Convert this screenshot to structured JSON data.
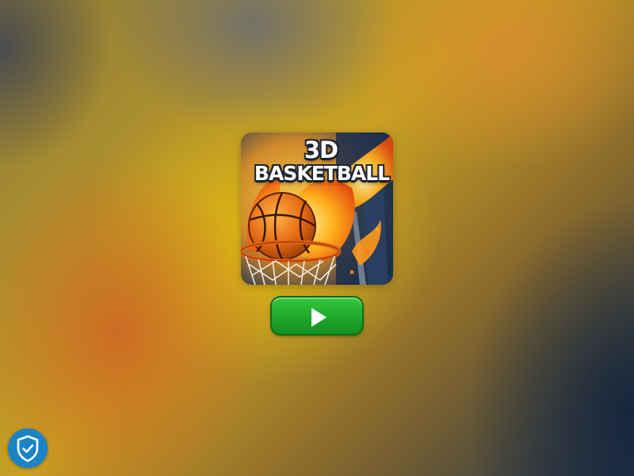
{
  "game": {
    "title_line1": "3D",
    "title_line2": "BASKETBALL",
    "thumbnail_icon": "basketball-flame-hoop"
  },
  "play_button": {
    "icon": "play-icon",
    "color": "#22a82c"
  },
  "privacy_button": {
    "icon": "shield-check-icon",
    "color": "#1a84c6"
  },
  "background": {
    "colors": [
      "#cd6923",
      "#deb614",
      "#16263c",
      "#6e6e6e"
    ]
  }
}
